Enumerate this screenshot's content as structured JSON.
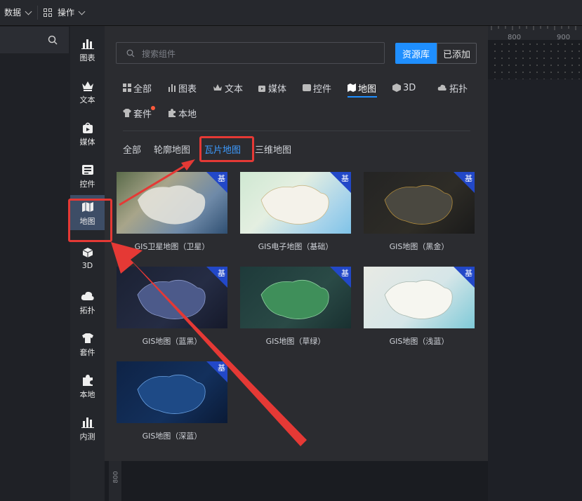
{
  "topbar": {
    "data_label": "数据",
    "ops_label": "操作"
  },
  "rail": {
    "items": [
      {
        "label": "图表"
      },
      {
        "label": "文本"
      },
      {
        "label": "媒体"
      },
      {
        "label": "控件"
      },
      {
        "label": "地图"
      },
      {
        "label": "3D"
      },
      {
        "label": "拓扑"
      },
      {
        "label": "套件"
      },
      {
        "label": "本地"
      },
      {
        "label": "内测"
      }
    ]
  },
  "panel": {
    "search_placeholder": "搜索组件",
    "btn_library": "资源库",
    "btn_added": "已添加",
    "categories": [
      {
        "label": "全部"
      },
      {
        "label": "图表"
      },
      {
        "label": "文本"
      },
      {
        "label": "媒体"
      },
      {
        "label": "控件"
      },
      {
        "label": "地图"
      },
      {
        "label": "3D"
      },
      {
        "label": "拓扑"
      },
      {
        "label": "套件"
      },
      {
        "label": "本地"
      }
    ],
    "subtabs": [
      {
        "label": "全部"
      },
      {
        "label": "轮廓地图"
      },
      {
        "label": "瓦片地图"
      },
      {
        "label": "三维地图"
      }
    ],
    "cards": [
      {
        "caption": "GIS卫星地图（卫星）",
        "badge": "基"
      },
      {
        "caption": "GIS电子地图（基础）",
        "badge": "基"
      },
      {
        "caption": "GIS地图（黑金）",
        "badge": "基"
      },
      {
        "caption": "GIS地图（蓝黑）",
        "badge": "基"
      },
      {
        "caption": "GIS地图（草绿）",
        "badge": "基"
      },
      {
        "caption": "GIS地图（浅蓝）",
        "badge": "基"
      },
      {
        "caption": "GIS地图（深蓝）",
        "badge": "基"
      }
    ]
  },
  "ruler": {
    "label_800": "800",
    "label_900": "900",
    "vlabel": "800"
  },
  "colors": {
    "accent": "#1f8fff",
    "annotation": "#e53935",
    "badge": "#2248c8"
  }
}
